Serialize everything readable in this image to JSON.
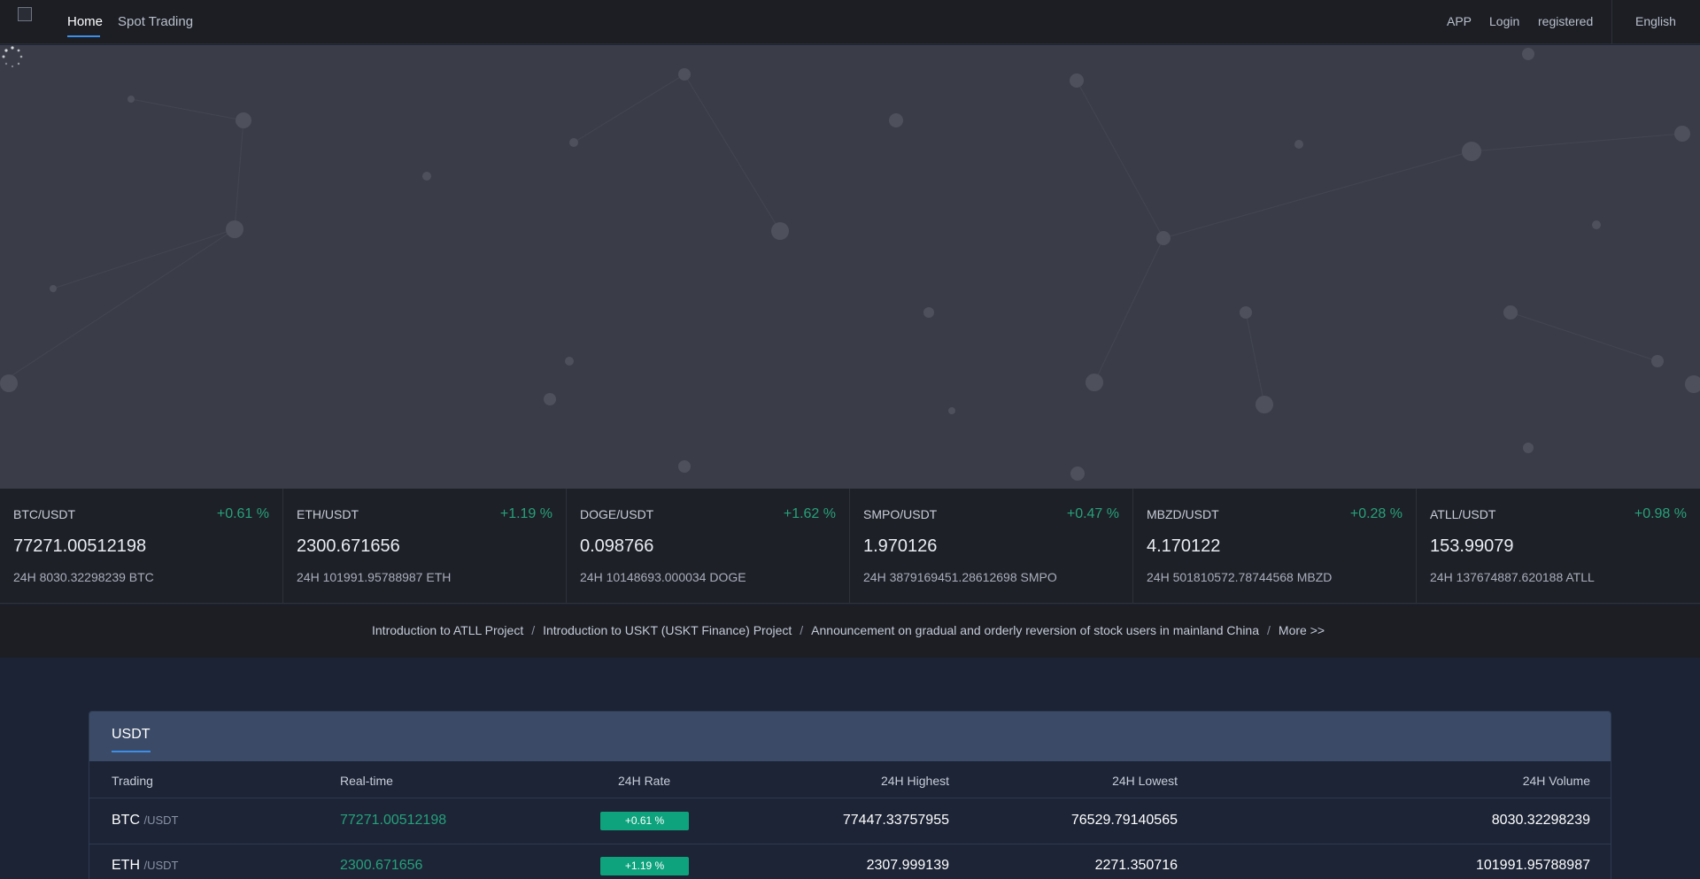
{
  "nav": {
    "home": "Home",
    "spot": "Spot Trading",
    "app": "APP",
    "login": "Login",
    "registered": "registered",
    "language": "English"
  },
  "tickers": [
    {
      "pair": "BTC/USDT",
      "change": "+0.61 %",
      "price": "77271.00512198",
      "volume": "24H 8030.32298239 BTC"
    },
    {
      "pair": "ETH/USDT",
      "change": "+1.19 %",
      "price": "2300.671656",
      "volume": "24H 101991.95788987 ETH"
    },
    {
      "pair": "DOGE/USDT",
      "change": "+1.62 %",
      "price": "0.098766",
      "volume": "24H 10148693.000034 DOGE"
    },
    {
      "pair": "SMPO/USDT",
      "change": "+0.47 %",
      "price": "1.970126",
      "volume": "24H 3879169451.28612698 SMPO"
    },
    {
      "pair": "MBZD/USDT",
      "change": "+0.28 %",
      "price": "4.170122",
      "volume": "24H 501810572.78744568 MBZD"
    },
    {
      "pair": "ATLL/USDT",
      "change": "+0.98 %",
      "price": "153.99079",
      "volume": "24H 137674887.620188 ATLL"
    }
  ],
  "announcements": {
    "items": [
      "Introduction to ATLL Project",
      "Introduction to USKT (USKT Finance) Project",
      "Announcement on gradual and orderly reversion of stock users in mainland China"
    ],
    "separator": "/",
    "more": "More >>"
  },
  "market": {
    "tab": "USDT",
    "columns": {
      "trading": "Trading",
      "realtime": "Real-time",
      "rate": "24H Rate",
      "highest": "24H Highest",
      "lowest": "24H Lowest",
      "volume": "24H Volume"
    },
    "rows": [
      {
        "symbol": "BTC",
        "quote": "/USDT",
        "realtime": "77271.00512198",
        "rate": "+0.61 %",
        "highest": "77447.33757955",
        "lowest": "76529.79140565",
        "volume": "8030.32298239"
      },
      {
        "symbol": "ETH",
        "quote": "/USDT",
        "realtime": "2300.671656",
        "rate": "+1.19 %",
        "highest": "2307.999139",
        "lowest": "2271.350716",
        "volume": "101991.95788987"
      }
    ]
  },
  "colors": {
    "up": "#26a17b",
    "badge": "#0ea37d",
    "accent": "#3b8fe8",
    "nav_bg": "#1c1e24",
    "banner_bg": "#3a3d48"
  }
}
